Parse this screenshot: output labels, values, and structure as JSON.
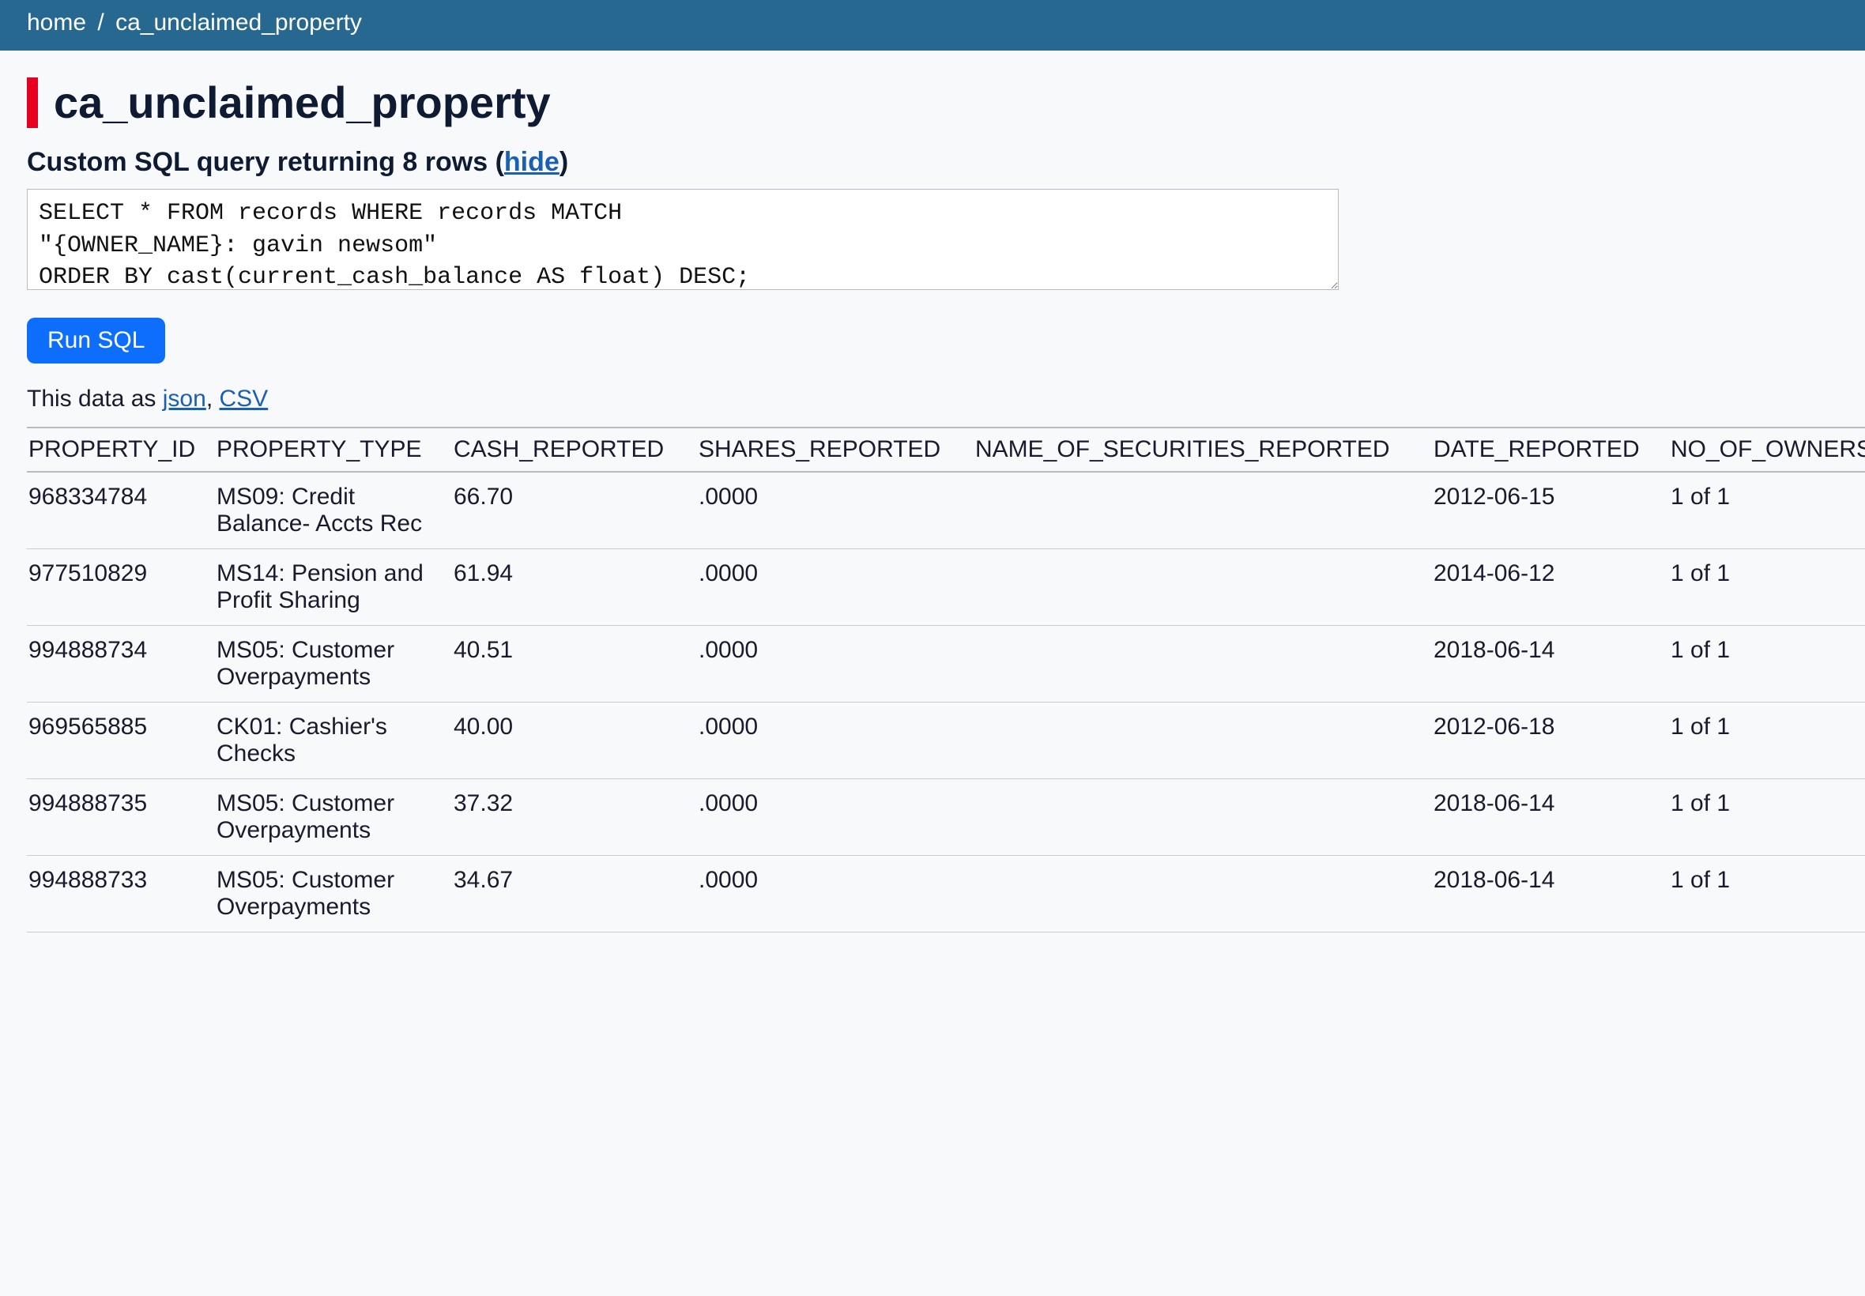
{
  "breadcrumb": {
    "home": "home",
    "sep": "/",
    "current": "ca_unclaimed_property"
  },
  "title": "ca_unclaimed_property",
  "subhead_prefix": "Custom SQL query returning 8 rows (",
  "subhead_link": "hide",
  "subhead_suffix": ")",
  "sql": "SELECT * FROM records WHERE records MATCH\n\"{OWNER_NAME}: gavin newsom\"\nORDER BY cast(current_cash_balance AS float) DESC;",
  "run_label": "Run SQL",
  "data_as_prefix": "This data as ",
  "data_as_json": "json",
  "data_as_sep": ", ",
  "data_as_csv": "CSV",
  "columns": [
    "PROPERTY_ID",
    "PROPERTY_TYPE",
    "CASH_REPORTED",
    "SHARES_REPORTED",
    "NAME_OF_SECURITIES_REPORTED",
    "DATE_REPORTED",
    "NO_OF_OWNERS"
  ],
  "rows": [
    {
      "PROPERTY_ID": "968334784",
      "PROPERTY_TYPE": "MS09: Credit Balance- Accts Rec",
      "CASH_REPORTED": "66.70",
      "SHARES_REPORTED": ".0000",
      "NAME_OF_SECURITIES_REPORTED": "",
      "DATE_REPORTED": "2012-06-15",
      "NO_OF_OWNERS": "1 of 1"
    },
    {
      "PROPERTY_ID": "977510829",
      "PROPERTY_TYPE": "MS14: Pension and Profit Sharing",
      "CASH_REPORTED": "61.94",
      "SHARES_REPORTED": ".0000",
      "NAME_OF_SECURITIES_REPORTED": "",
      "DATE_REPORTED": "2014-06-12",
      "NO_OF_OWNERS": "1 of 1"
    },
    {
      "PROPERTY_ID": "994888734",
      "PROPERTY_TYPE": "MS05: Customer Overpayments",
      "CASH_REPORTED": "40.51",
      "SHARES_REPORTED": ".0000",
      "NAME_OF_SECURITIES_REPORTED": "",
      "DATE_REPORTED": "2018-06-14",
      "NO_OF_OWNERS": "1 of 1"
    },
    {
      "PROPERTY_ID": "969565885",
      "PROPERTY_TYPE": "CK01: Cashier's Checks",
      "CASH_REPORTED": "40.00",
      "SHARES_REPORTED": ".0000",
      "NAME_OF_SECURITIES_REPORTED": "",
      "DATE_REPORTED": "2012-06-18",
      "NO_OF_OWNERS": "1 of 1"
    },
    {
      "PROPERTY_ID": "994888735",
      "PROPERTY_TYPE": "MS05: Customer Overpayments",
      "CASH_REPORTED": "37.32",
      "SHARES_REPORTED": ".0000",
      "NAME_OF_SECURITIES_REPORTED": "",
      "DATE_REPORTED": "2018-06-14",
      "NO_OF_OWNERS": "1 of 1"
    },
    {
      "PROPERTY_ID": "994888733",
      "PROPERTY_TYPE": "MS05: Customer Overpayments",
      "CASH_REPORTED": "34.67",
      "SHARES_REPORTED": ".0000",
      "NAME_OF_SECURITIES_REPORTED": "",
      "DATE_REPORTED": "2018-06-14",
      "NO_OF_OWNERS": "1 of 1"
    }
  ],
  "col_widths": {
    "PROPERTY_ID": "240px",
    "PROPERTY_TYPE": "300px",
    "CASH_REPORTED": "310px",
    "SHARES_REPORTED": "350px",
    "NAME_OF_SECURITIES_REPORTED": "580px",
    "DATE_REPORTED": "300px",
    "NO_OF_OWNERS": "280px"
  }
}
